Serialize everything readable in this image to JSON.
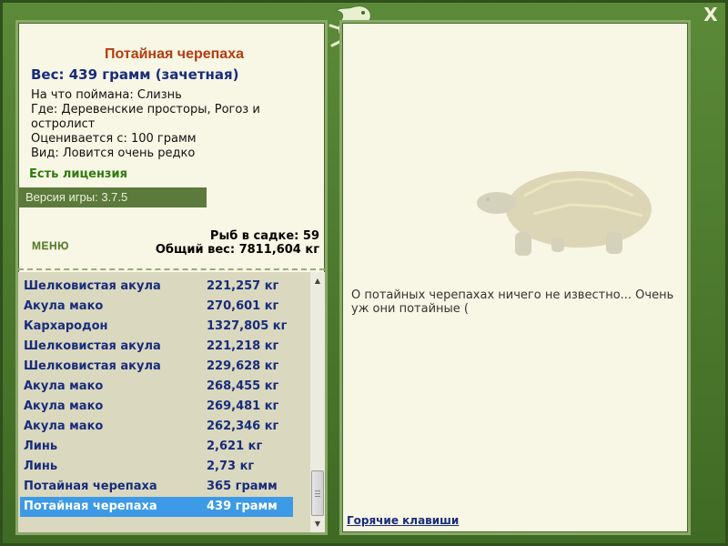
{
  "fish": {
    "title": "Потайная черепаха",
    "weight_line": "Вес: 439 грамм (зачетная)",
    "bait": "На что поймана: Слизнь",
    "location": "Где: Деревенские просторы, Рогоз и остролист",
    "rated_from": "Оценивается с: 100 грамм",
    "kind": "Вид: Ловится очень редко",
    "license": "Есть лицензия"
  },
  "version": "Версия игры: 3.7.5",
  "menu_label": "МЕНЮ",
  "stats": {
    "fish_in_cage": "Рыб в садке: 59",
    "total_weight": "Общий вес: 7811,604 кг"
  },
  "catch_list": [
    {
      "name": "Шелковистая акула",
      "weight": "221,257 кг"
    },
    {
      "name": "Акула мако",
      "weight": "270,601 кг"
    },
    {
      "name": "Кархародон",
      "weight": "1327,805 кг"
    },
    {
      "name": "Шелковистая акула",
      "weight": "221,218 кг"
    },
    {
      "name": "Шелковистая акула",
      "weight": "229,628 кг"
    },
    {
      "name": "Акула мако",
      "weight": "268,455 кг"
    },
    {
      "name": "Акула мако",
      "weight": "269,481 кг"
    },
    {
      "name": "Акула мако",
      "weight": "262,346 кг"
    },
    {
      "name": "Линь",
      "weight": "2,621 кг"
    },
    {
      "name": "Линь",
      "weight": "2,73 кг"
    },
    {
      "name": "Потайная черепаха",
      "weight": "365 грамм"
    },
    {
      "name": "Потайная черепаха",
      "weight": "439 грамм",
      "selected": true
    }
  ],
  "description": "О потайных черепахах ничего не известно... Очень уж они потайные (",
  "hotkeys_label": "Горячие клавиши",
  "close_label": "X",
  "icons": [
    "lizard-logo-icon",
    "turtle-illustration-icon",
    "scroll-up-icon",
    "scroll-down-icon"
  ],
  "colors": {
    "frame_green": "#4e7a30",
    "panel_bg": "#f8f6e4",
    "title_orange": "#b43c10",
    "text_navy": "#182c7c",
    "license_green": "#2f7a10",
    "selected_blue": "#3c9ae6"
  }
}
